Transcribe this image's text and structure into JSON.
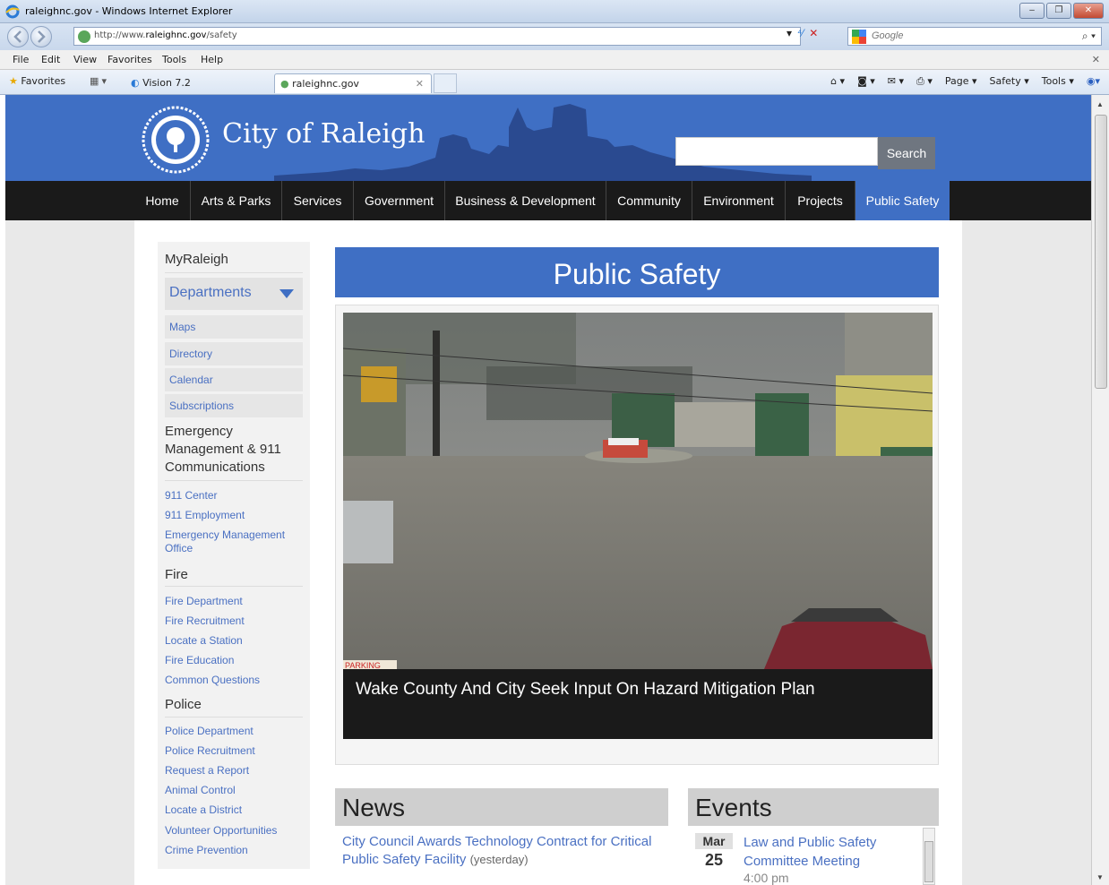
{
  "window": {
    "title": "raleighnc.gov - Windows Internet Explorer",
    "buttons": {
      "minimize": "‒",
      "restore": "❐",
      "close": "✕"
    }
  },
  "address": {
    "url_prefix": "http://www.",
    "url_domain": "raleighnc.gov",
    "url_path": "/safety",
    "search_placeholder": "Google",
    "tools": {
      "dropdown": "▾",
      "refresh": "⁴⁄",
      "stop": "✕"
    }
  },
  "menu": [
    "File",
    "Edit",
    "View",
    "Favorites",
    "Tools",
    "Help"
  ],
  "favorites_bar": {
    "favorites_label": "Favorites",
    "tab_vision": "Vision 7.2",
    "tab_active": "raleighnc.gov",
    "command_items": [
      "Page ▾",
      "Safety ▾",
      "Tools ▾"
    ]
  },
  "site": {
    "title": "City of Raleigh",
    "search_button": "Search",
    "nav": [
      "Home",
      "Arts & Parks",
      "Services",
      "Government",
      "Business & Development",
      "Community",
      "Environment",
      "Projects",
      "Public Safety"
    ],
    "active_nav": "Public Safety"
  },
  "sidebar": {
    "myraleigh": "MyRaleigh",
    "departments": "Departments",
    "quick_links": [
      "Maps",
      "Directory",
      "Calendar",
      "Subscriptions"
    ],
    "emergency_heading": "Emergency Management & 911 Communications",
    "emergency_links": [
      "911 Center",
      "911 Employment",
      "Emergency Management Office"
    ],
    "fire_heading": "Fire",
    "fire_links": [
      "Fire Department",
      "Fire Recruitment",
      "Locate a Station",
      "Fire Education",
      "Common Questions"
    ],
    "police_heading": "Police",
    "police_links": [
      "Police Department",
      "Police Recruitment",
      "Request a Report",
      "Animal Control",
      "Locate a District",
      "Volunteer Opportunities",
      "Crime Prevention"
    ]
  },
  "main": {
    "page_title": "Public Safety",
    "slide_caption": "Wake County And City Seek Input On Hazard Mitigation Plan",
    "slide_sign": "PARKING",
    "news": {
      "heading": "News",
      "item_title": "City Council Awards Technology Contract for Critical Public Safety Facility",
      "item_when": "(yesterday)"
    },
    "events": {
      "heading": "Events",
      "month": "Mar",
      "day": "25",
      "title": "Law and Public Safety Committee Meeting",
      "time": "4:00 pm"
    }
  },
  "colors": {
    "brand_blue": "#3f6fc4",
    "nav_black": "#1a1a1a",
    "link_blue": "#4a70c2"
  }
}
